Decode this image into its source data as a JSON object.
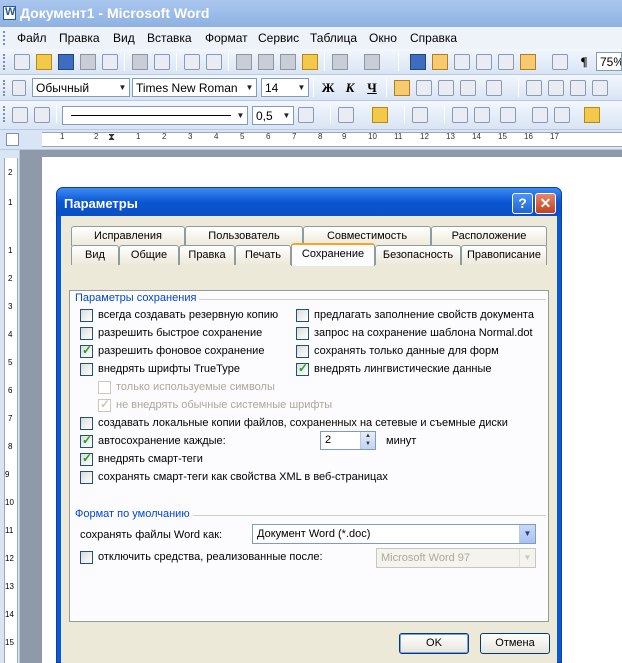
{
  "window": {
    "title": "Документ1 - Microsoft Word"
  },
  "menu": [
    "Файл",
    "Правка",
    "Вид",
    "Вставка",
    "Формат",
    "Сервис",
    "Таблица",
    "Окно",
    "Справка"
  ],
  "toolbar_format": {
    "style": "Обычный",
    "font": "Times New Roman",
    "size": "14",
    "zoom": "75%"
  },
  "toolbar_draw": {
    "line_width": "0,5"
  },
  "ruler": {
    "h_numbers": [
      "1",
      "2",
      "1",
      "2",
      "3",
      "4",
      "5",
      "6",
      "7",
      "8",
      "9",
      "10",
      "11",
      "12",
      "13",
      "14",
      "15",
      "16",
      "17"
    ],
    "v_numbers": [
      "2",
      "1",
      "1",
      "2",
      "3",
      "4",
      "5",
      "6",
      "7",
      "8",
      "9",
      "10",
      "11",
      "12",
      "13",
      "14",
      "15"
    ]
  },
  "dialog": {
    "title": "Параметры",
    "help_glyph": "?",
    "close_glyph": "✕",
    "tabs_row1": [
      "Исправления",
      "Пользователь",
      "Совместимость",
      "Расположение"
    ],
    "tabs_row2": [
      "Вид",
      "Общие",
      "Правка",
      "Печать",
      "Сохранение",
      "Безопасность",
      "Правописание"
    ],
    "selected_tab": "Сохранение",
    "save_group": {
      "label": "Параметры сохранения",
      "left": [
        {
          "label": "всегда создавать резервную копию",
          "checked": false
        },
        {
          "label": "разрешить быстрое сохранение",
          "checked": false
        },
        {
          "label": "разрешить фоновое сохранение",
          "checked": true
        },
        {
          "label": "внедрять шрифты TrueType",
          "checked": false
        }
      ],
      "right": [
        {
          "label": "предлагать заполнение свойств документа",
          "checked": false
        },
        {
          "label": "запрос на сохранение шаблона Normal.dot",
          "checked": false
        },
        {
          "label": "сохранять только данные для форм",
          "checked": false
        },
        {
          "label": "внедрять лингвистические данные",
          "checked": true
        }
      ],
      "sub": [
        {
          "label": "только используемые символы",
          "checked": false,
          "disabled": true
        },
        {
          "label": "не внедрять обычные системные шрифты",
          "checked": true,
          "disabled": true
        }
      ],
      "local_copies": {
        "label": "создавать локальные копии файлов, сохраненных на сетевые и съемные диски",
        "checked": false
      },
      "autosave": {
        "label": "автосохранение каждые:",
        "checked": true,
        "value": "2",
        "unit": "минут"
      },
      "smart_tags": {
        "label": "внедрять смарт-теги",
        "checked": true
      },
      "smart_xml": {
        "label": "сохранять смарт-теги как свойства XML в веб-страницах",
        "checked": false
      }
    },
    "format_group": {
      "label": "Формат по умолчанию",
      "save_as_label": "сохранять файлы Word как:",
      "save_as_value": "Документ Word (*.doc)",
      "disable_label": "отключить средства, реализованные после:",
      "disable_checked": false,
      "disable_value": "Microsoft Word 97"
    },
    "ok": "OK",
    "cancel": "Отмена"
  },
  "colors": {
    "xp_blue": "#0a58d8",
    "dialog_face": "#ece9d8",
    "tab_accent": "#f5a623",
    "check_green": "#21a121"
  }
}
